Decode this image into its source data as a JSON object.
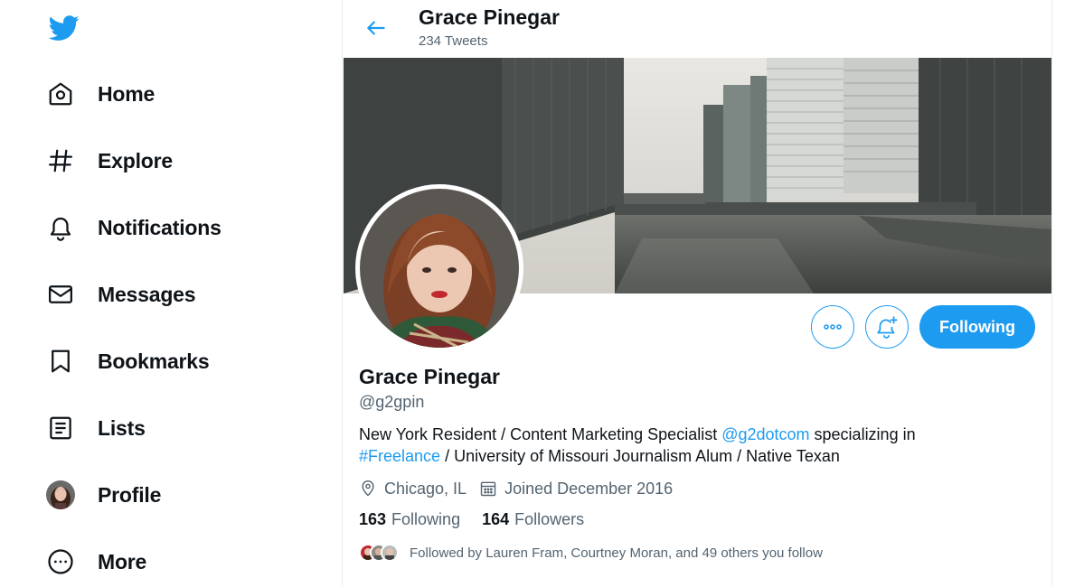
{
  "nav": {
    "items": [
      {
        "label": "Home",
        "icon": "home-icon"
      },
      {
        "label": "Explore",
        "icon": "hashtag-icon"
      },
      {
        "label": "Notifications",
        "icon": "bell-icon"
      },
      {
        "label": "Messages",
        "icon": "envelope-icon"
      },
      {
        "label": "Bookmarks",
        "icon": "bookmark-icon"
      },
      {
        "label": "Lists",
        "icon": "list-icon"
      },
      {
        "label": "Profile",
        "icon": "avatar"
      },
      {
        "label": "More",
        "icon": "more-circle-icon"
      }
    ]
  },
  "header": {
    "title": "Grace Pinegar",
    "subtitle": "234 Tweets"
  },
  "profile": {
    "name": "Grace Pinegar",
    "handle": "@g2gpin",
    "bio": {
      "part1": "New York Resident / Content Marketing Specialist ",
      "mention": "@g2dotcom",
      "part2": " specializing in",
      "hashtag": "#Freelance",
      "part3": " / University of Missouri Journalism Alum / Native Texan"
    },
    "location": "Chicago, IL",
    "joined": "Joined December 2016",
    "following_count": "163",
    "following_label": "Following",
    "followers_count": "164",
    "followers_label": "Followers",
    "followed_by": "Followed by Lauren Fram, Courtney Moran, and 49 others you follow"
  },
  "actions": {
    "more_icon": "more-dots-icon",
    "notify_icon": "bell-plus-icon",
    "follow_label": "Following"
  },
  "colors": {
    "accent": "#1d9bf0",
    "text": "#0f1419",
    "secondary": "#536471"
  }
}
